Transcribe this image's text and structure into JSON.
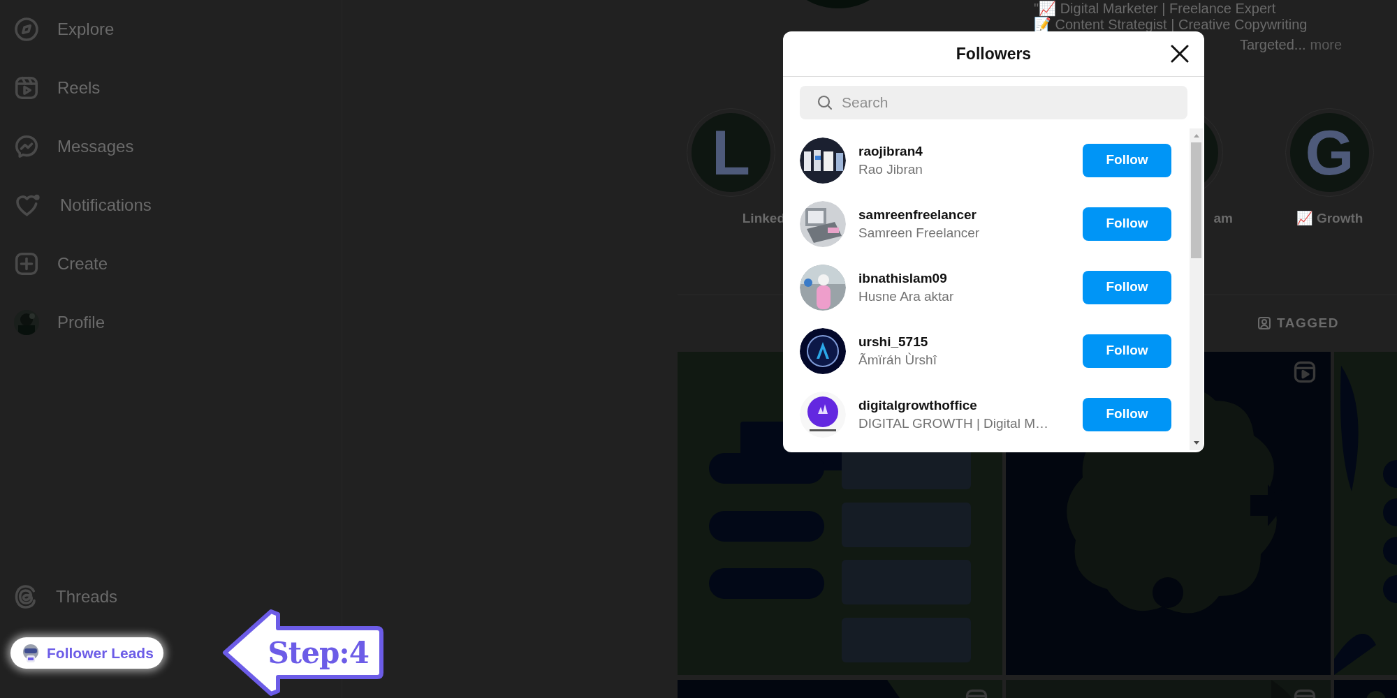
{
  "sidebar": {
    "items": [
      {
        "label": "Explore"
      },
      {
        "label": "Reels"
      },
      {
        "label": "Messages"
      },
      {
        "label": "Notifications"
      },
      {
        "label": "Create"
      },
      {
        "label": "Profile"
      }
    ],
    "bottom_items": [
      {
        "label": "Threads"
      }
    ]
  },
  "profile": {
    "bio_lines": [
      "\"📈 Digital Marketer | Freelance Expert",
      "📝 Content Strategist | Creative Copywriting",
      "Targeted..."
    ],
    "more_link": "more",
    "highlights": [
      {
        "label": "Linked",
        "letter": "L"
      },
      {
        "label": "am"
      },
      {
        "label": "📈 Growth",
        "letter": "G"
      }
    ],
    "tabs": [
      {
        "label": "TAGGED"
      }
    ]
  },
  "modal": {
    "title": "Followers",
    "search": {
      "placeholder": "Search"
    },
    "followers": [
      {
        "username": "raojibran4",
        "name": "Rao Jibran",
        "button": "Follow"
      },
      {
        "username": "samreenfreelancer",
        "name": "Samreen Freelancer",
        "button": "Follow"
      },
      {
        "username": "ibnathislam09",
        "name": "Husne Ara aktar",
        "button": "Follow"
      },
      {
        "username": "urshi_5715",
        "name": "Ãmïráh Ùrshî",
        "button": "Follow"
      },
      {
        "username": "digitalgrowthoffice",
        "name": "DIGITAL GROWTH | Digital M…",
        "button": "Follow"
      }
    ]
  },
  "extension_button": {
    "label": "Follower Leads"
  },
  "annotation": {
    "label": "Step:4"
  }
}
